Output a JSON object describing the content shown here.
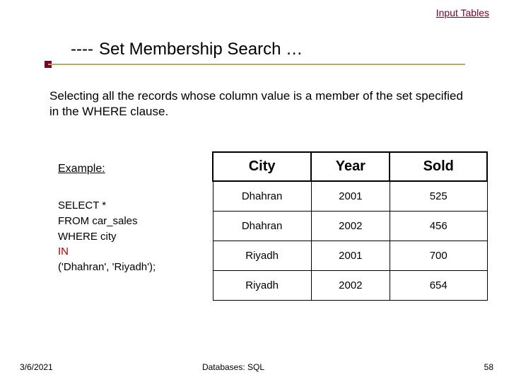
{
  "top_link": "Input Tables",
  "title": {
    "dashes": "----",
    "text": "Set Membership Search …"
  },
  "intro": "Selecting all the records whose column value is a member of the set specified in the WHERE clause.",
  "example_label": "Example:",
  "sql": {
    "line1": "SELECT *",
    "line2": "FROM car_sales",
    "line3": "WHERE city",
    "kw_in": "IN",
    "line5": "('Dhahran', 'Riyadh');"
  },
  "table": {
    "headers": {
      "c0": "City",
      "c1": "Year",
      "c2": "Sold"
    },
    "rows": [
      {
        "c0": "Dhahran",
        "c1": "2001",
        "c2": "525"
      },
      {
        "c0": "Dhahran",
        "c1": "2002",
        "c2": "456"
      },
      {
        "c0": "Riyadh",
        "c1": "2001",
        "c2": "700"
      },
      {
        "c0": "Riyadh",
        "c1": "2002",
        "c2": "654"
      }
    ]
  },
  "footer": {
    "date": "3/6/2021",
    "center": "Databases: SQL",
    "page": "58"
  },
  "chart_data": {
    "type": "table",
    "title": "Set Membership Search result",
    "columns": [
      "City",
      "Year",
      "Sold"
    ],
    "rows": [
      [
        "Dhahran",
        2001,
        525
      ],
      [
        "Dhahran",
        2002,
        456
      ],
      [
        "Riyadh",
        2001,
        700
      ],
      [
        "Riyadh",
        2002,
        654
      ]
    ]
  }
}
